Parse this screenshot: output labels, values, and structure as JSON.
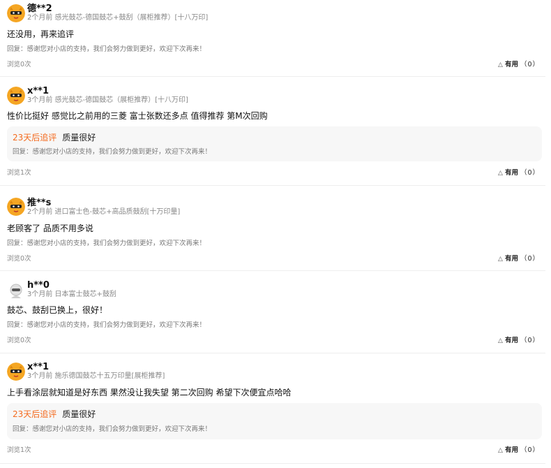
{
  "reviews": [
    {
      "username": "德**2",
      "avatar": "orange-masked-mascot-icon",
      "meta": "2个月前 感光鼓芯-德国鼓芯+鼓刮（展柜推荐）[十八万印]",
      "content": "还没用，再来追评",
      "followup": null,
      "reply": "回复：感谢您对小店的支持，我们会努力做到更好，欢迎下次再来！",
      "views": "浏览0次",
      "helpful_label": "有用",
      "helpful_count": "（0）"
    },
    {
      "username": "x**1",
      "avatar": "orange-masked-mascot-icon",
      "meta": "3个月前 感光鼓芯-德国鼓芯（展柜推荐）[十八万印]",
      "content": "性价比挺好 感觉比之前用的三菱 富士张数还多点 值得推荐 第M次回购",
      "followup": {
        "days": "23天后追评",
        "text": "质量很好"
      },
      "reply": "回复：感谢您对小店的支持，我们会努力做到更好，欢迎下次再来！",
      "views": "浏览1次",
      "helpful_label": "有用",
      "helpful_count": "（0）"
    },
    {
      "username": "推**s",
      "avatar": "orange-masked-mascot-icon",
      "meta": "2个月前 进口富士色-鼓芯+高品质鼓刮[十万印量]",
      "content": "老顾客了 品质不用多说",
      "followup": null,
      "reply": "回复：感谢您对小店的支持，我们会努力做到更好，欢迎下次再来！",
      "views": "浏览0次",
      "helpful_label": "有用",
      "helpful_count": "（0）"
    },
    {
      "username": "h**0",
      "avatar": "gray-default-avatar-icon",
      "meta": "3个月前 日本富士鼓芯+鼓刮",
      "content": "鼓芯、鼓刮已换上，很好！",
      "followup": null,
      "reply": "回复：感谢您对小店的支持，我们会努力做到更好，欢迎下次再来！",
      "views": "浏览0次",
      "helpful_label": "有用",
      "helpful_count": "（0）"
    },
    {
      "username": "x**1",
      "avatar": "orange-masked-mascot-icon",
      "meta": "3个月前 施乐德国鼓芯十五万印量[展柜推荐]",
      "content": "上手看涂层就知道是好东西 果然没让我失望 第二次回购 希望下次便宜点哈哈",
      "followup": {
        "days": "23天后追评",
        "text": "质量很好"
      },
      "reply": "回复：感谢您对小店的支持，我们会努力做到更好，欢迎下次再来！",
      "views": "浏览1次",
      "helpful_label": "有用",
      "helpful_count": "（0）"
    }
  ],
  "colors": {
    "followup_accent": "#f46b1f",
    "mascot": "#f5a623"
  }
}
